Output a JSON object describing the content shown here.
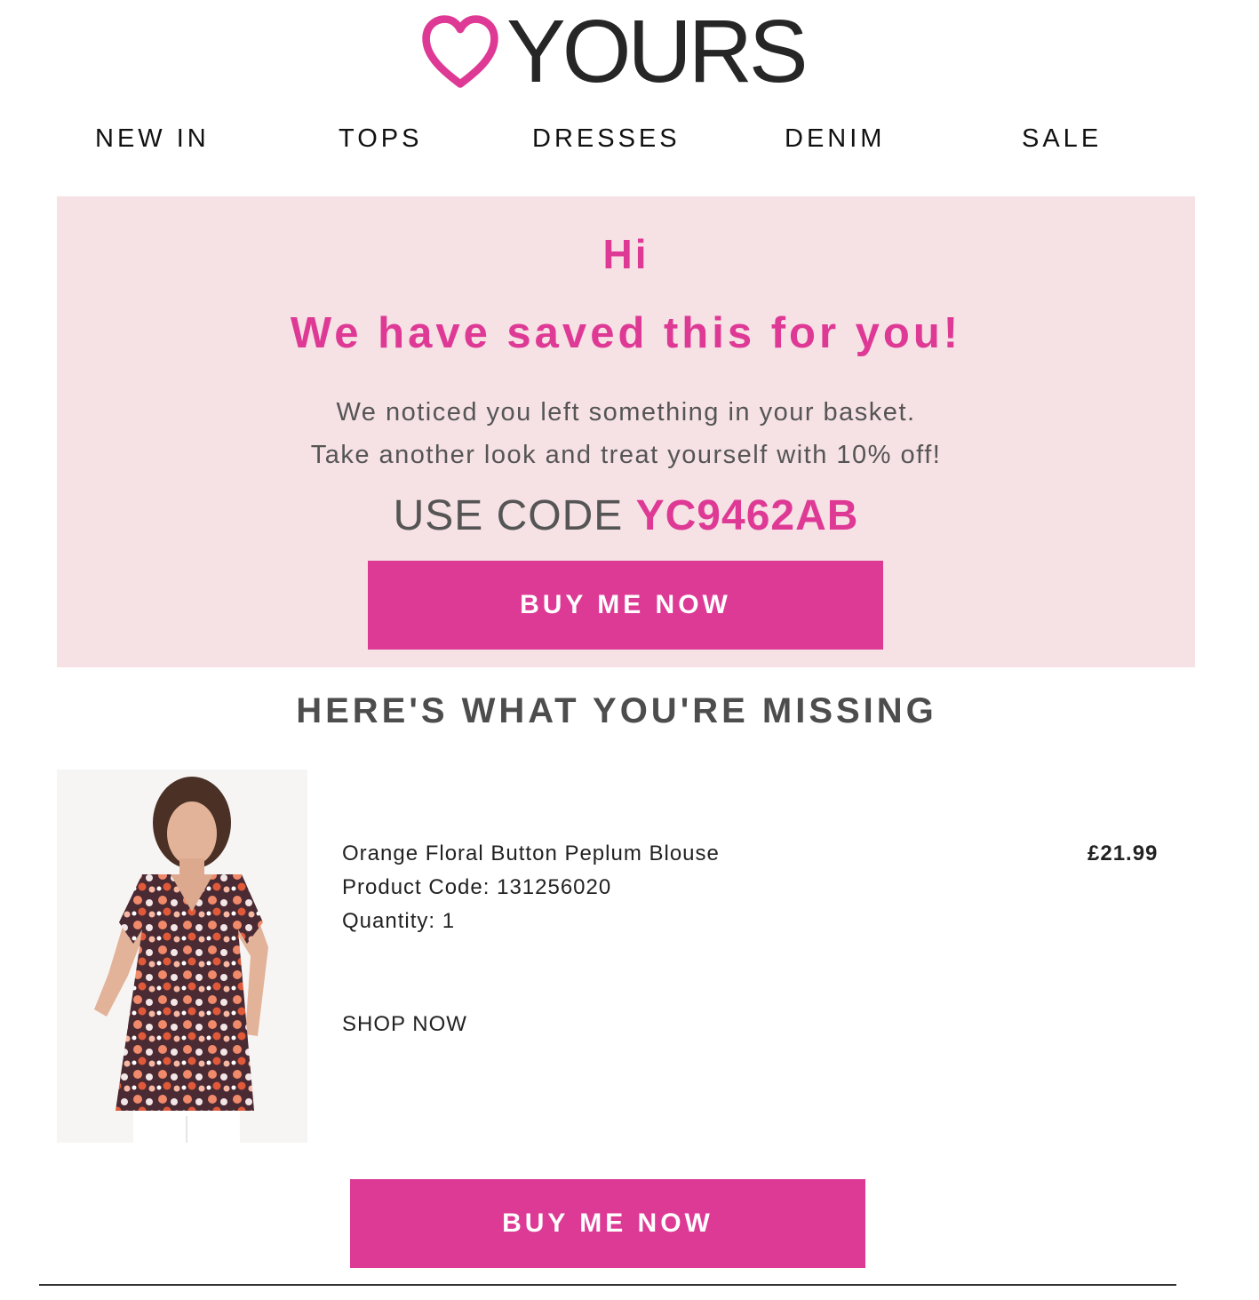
{
  "brand": {
    "name": "YOURS",
    "accent_color": "#dd3a96",
    "logo_icon": "heart-outline-icon"
  },
  "nav": {
    "items": [
      "NEW IN",
      "TOPS",
      "DRESSES",
      "DENIM",
      "SALE"
    ]
  },
  "hero": {
    "greeting": "Hi",
    "title": "We have saved this for you!",
    "line1": "We noticed you left something in your basket.",
    "line2": "Take another look and treat yourself with 10% off!",
    "code_prefix": "USE CODE",
    "code": "YC9462AB",
    "button_label": "BUY ME NOW",
    "background_color": "#f6e1e5"
  },
  "missing_heading": "HERE'S WHAT YOU'RE MISSING",
  "product": {
    "name": "Orange Floral Button Peplum Blouse",
    "code_line": "Product Code: 131256020",
    "quantity_line": "Quantity: 1",
    "price": "£21.99",
    "shop_now": "SHOP NOW"
  },
  "bottom_button_label": "BUY ME NOW"
}
